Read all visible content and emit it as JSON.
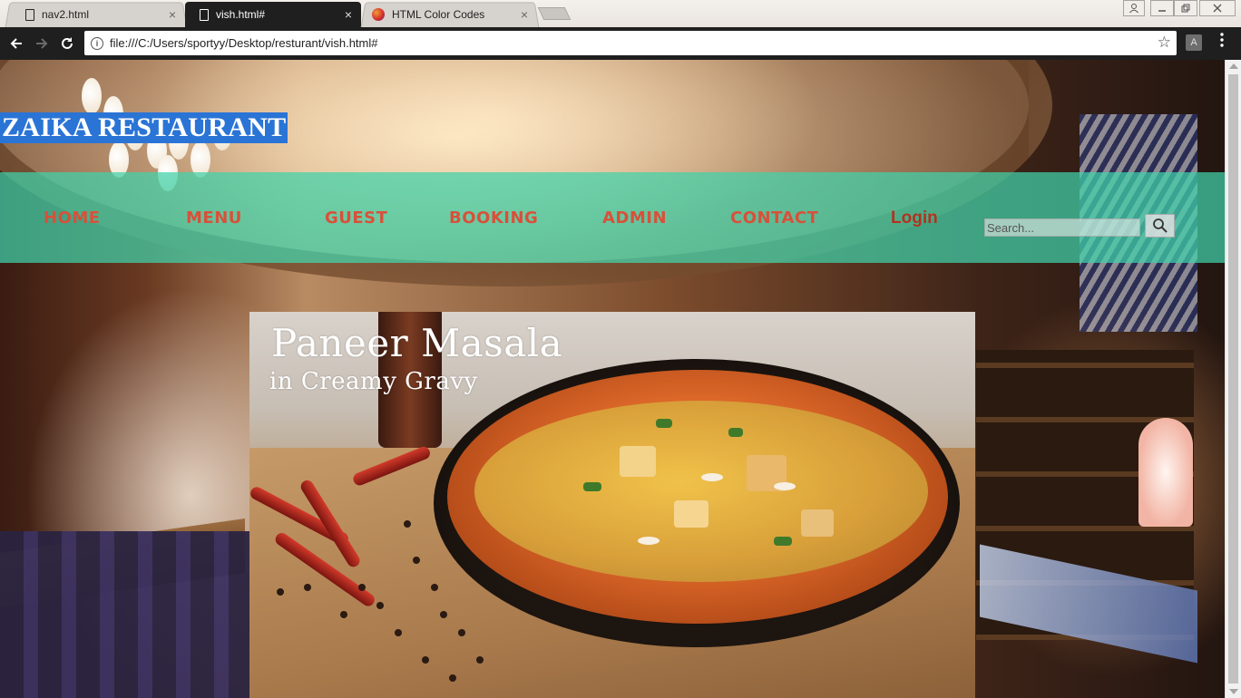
{
  "browser": {
    "tabs": [
      {
        "title": "nav2.html",
        "icon": "document-icon",
        "active": false
      },
      {
        "title": "vish.html#",
        "icon": "document-icon",
        "active": true
      },
      {
        "title": "HTML Color Codes",
        "icon": "favicon-icon",
        "active": false
      }
    ],
    "close_glyph": "×",
    "url": "file:///C:/Users/sportyy/Desktop/resturant/vish.html#",
    "info_glyph": "i",
    "star_glyph": "☆",
    "ext_glyph": "A"
  },
  "site": {
    "title": "ZAIKA RESTAURANT",
    "nav": [
      "HOME",
      "MENU",
      "GUEST",
      "BOOKING",
      "ADMIN",
      "CONTACT",
      "Login"
    ],
    "search_placeholder": "Search...",
    "colors": {
      "nav_band": "#40d2aa",
      "nav_text": "#d9503a",
      "title_highlight": "#2a74d6"
    }
  },
  "hero": {
    "title": "Paneer Masala",
    "subtitle": "in Creamy Gravy"
  }
}
